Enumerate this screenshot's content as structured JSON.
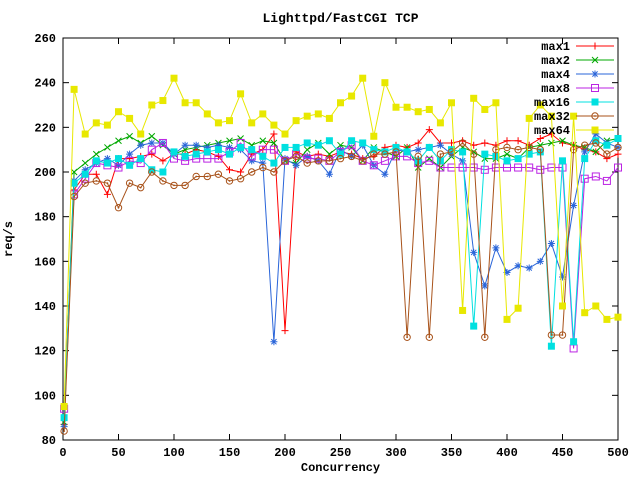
{
  "chart_data": {
    "type": "line",
    "title": "Lighttpd/FastCGI TCP",
    "xlabel": "Concurrency",
    "ylabel": "req/s",
    "xlim": [
      0,
      500
    ],
    "ylim": [
      80,
      260
    ],
    "xticks": [
      0,
      50,
      100,
      150,
      200,
      250,
      300,
      350,
      400,
      450,
      500
    ],
    "yticks": [
      80,
      100,
      120,
      140,
      160,
      180,
      200,
      220,
      240,
      260
    ],
    "grid": false,
    "legend_position": "top-right-inside",
    "x": [
      1,
      10,
      20,
      30,
      40,
      50,
      60,
      70,
      80,
      90,
      100,
      110,
      120,
      130,
      140,
      150,
      160,
      170,
      180,
      190,
      200,
      210,
      220,
      230,
      240,
      250,
      260,
      270,
      280,
      290,
      300,
      310,
      320,
      330,
      340,
      350,
      360,
      370,
      380,
      390,
      400,
      410,
      420,
      430,
      440,
      450,
      460,
      470,
      480,
      490,
      500
    ],
    "series": [
      {
        "name": "max1",
        "color": "#ff0000",
        "marker": "plus",
        "values": [
          87,
          192,
          199,
          199,
          190,
          206,
          206,
          207,
          208,
          205,
          208,
          208,
          210,
          209,
          207,
          201,
          200,
          208,
          210,
          217,
          129,
          209,
          207,
          208,
          207,
          209,
          208,
          206,
          207,
          211,
          212,
          211,
          213,
          219,
          213,
          213,
          214,
          212,
          213,
          212,
          214,
          214,
          212,
          215,
          217,
          213,
          212,
          210,
          209,
          206,
          208
        ]
      },
      {
        "name": "max2",
        "color": "#00a800",
        "marker": "cross",
        "values": [
          88,
          200,
          204,
          208,
          211,
          214,
          216,
          213,
          216,
          212,
          208,
          210,
          211,
          212,
          213,
          214,
          215,
          212,
          214,
          213,
          205,
          204,
          210,
          213,
          208,
          212,
          211,
          205,
          211,
          209,
          207,
          211,
          202,
          206,
          202,
          207,
          211,
          209,
          206,
          206,
          208,
          206,
          211,
          212,
          213,
          214,
          212,
          211,
          209,
          214,
          215
        ]
      },
      {
        "name": "max4",
        "color": "#2a65d9",
        "marker": "asterisk",
        "values": [
          86,
          196,
          201,
          204,
          206,
          203,
          208,
          212,
          213,
          213,
          208,
          212,
          212,
          211,
          212,
          211,
          210,
          205,
          204,
          124,
          206,
          203,
          207,
          205,
          199,
          210,
          207,
          212,
          203,
          199,
          210,
          209,
          210,
          211,
          212,
          208,
          205,
          164,
          149,
          166,
          155,
          158,
          157,
          160,
          168,
          153,
          185,
          209,
          217,
          213,
          211
        ]
      },
      {
        "name": "max8",
        "color": "#bb23e3",
        "marker": "square",
        "values": [
          94,
          190,
          197,
          204,
          203,
          202,
          205,
          204,
          210,
          213,
          206,
          205,
          206,
          206,
          206,
          209,
          213,
          207,
          210,
          210,
          205,
          208,
          206,
          206,
          205,
          209,
          212,
          205,
          203,
          205,
          207,
          207,
          204,
          205,
          202,
          202,
          202,
          202,
          201,
          202,
          202,
          202,
          202,
          201,
          202,
          202,
          121,
          197,
          198,
          196,
          202
        ]
      },
      {
        "name": "max16",
        "color": "#00e0e0",
        "marker": "fsquare",
        "values": [
          90,
          195,
          199,
          205,
          204,
          206,
          203,
          206,
          201,
          200,
          209,
          207,
          208,
          209,
          210,
          208,
          211,
          210,
          207,
          204,
          211,
          211,
          213,
          212,
          214,
          208,
          214,
          213,
          210,
          209,
          211,
          209,
          205,
          211,
          205,
          210,
          209,
          131,
          208,
          207,
          205,
          206,
          208,
          209,
          122,
          205,
          124,
          206,
          214,
          212,
          215
        ]
      },
      {
        "name": "max32",
        "color": "#a8521a",
        "marker": "circledot",
        "values": [
          84,
          189,
          195,
          196,
          195,
          184,
          195,
          193,
          200,
          196,
          194,
          194,
          198,
          198,
          199,
          196,
          197,
          200,
          202,
          200,
          205,
          207,
          204,
          205,
          205,
          206,
          207,
          205,
          208,
          208,
          209,
          126,
          207,
          126,
          208,
          209,
          213,
          208,
          126,
          210,
          211,
          210,
          211,
          210,
          127,
          127,
          210,
          212,
          213,
          208,
          211
        ]
      },
      {
        "name": "max64",
        "color": "#e8e800",
        "marker": "fsquare",
        "values": [
          95,
          237,
          217,
          222,
          221,
          227,
          224,
          217,
          230,
          232,
          242,
          231,
          231,
          226,
          222,
          223,
          235,
          222,
          226,
          221,
          217,
          223,
          225,
          226,
          224,
          231,
          234,
          242,
          216,
          240,
          229,
          229,
          227,
          228,
          222,
          231,
          138,
          233,
          228,
          231,
          134,
          139,
          224,
          230,
          225,
          140,
          225,
          137,
          140,
          134,
          135
        ]
      }
    ]
  }
}
